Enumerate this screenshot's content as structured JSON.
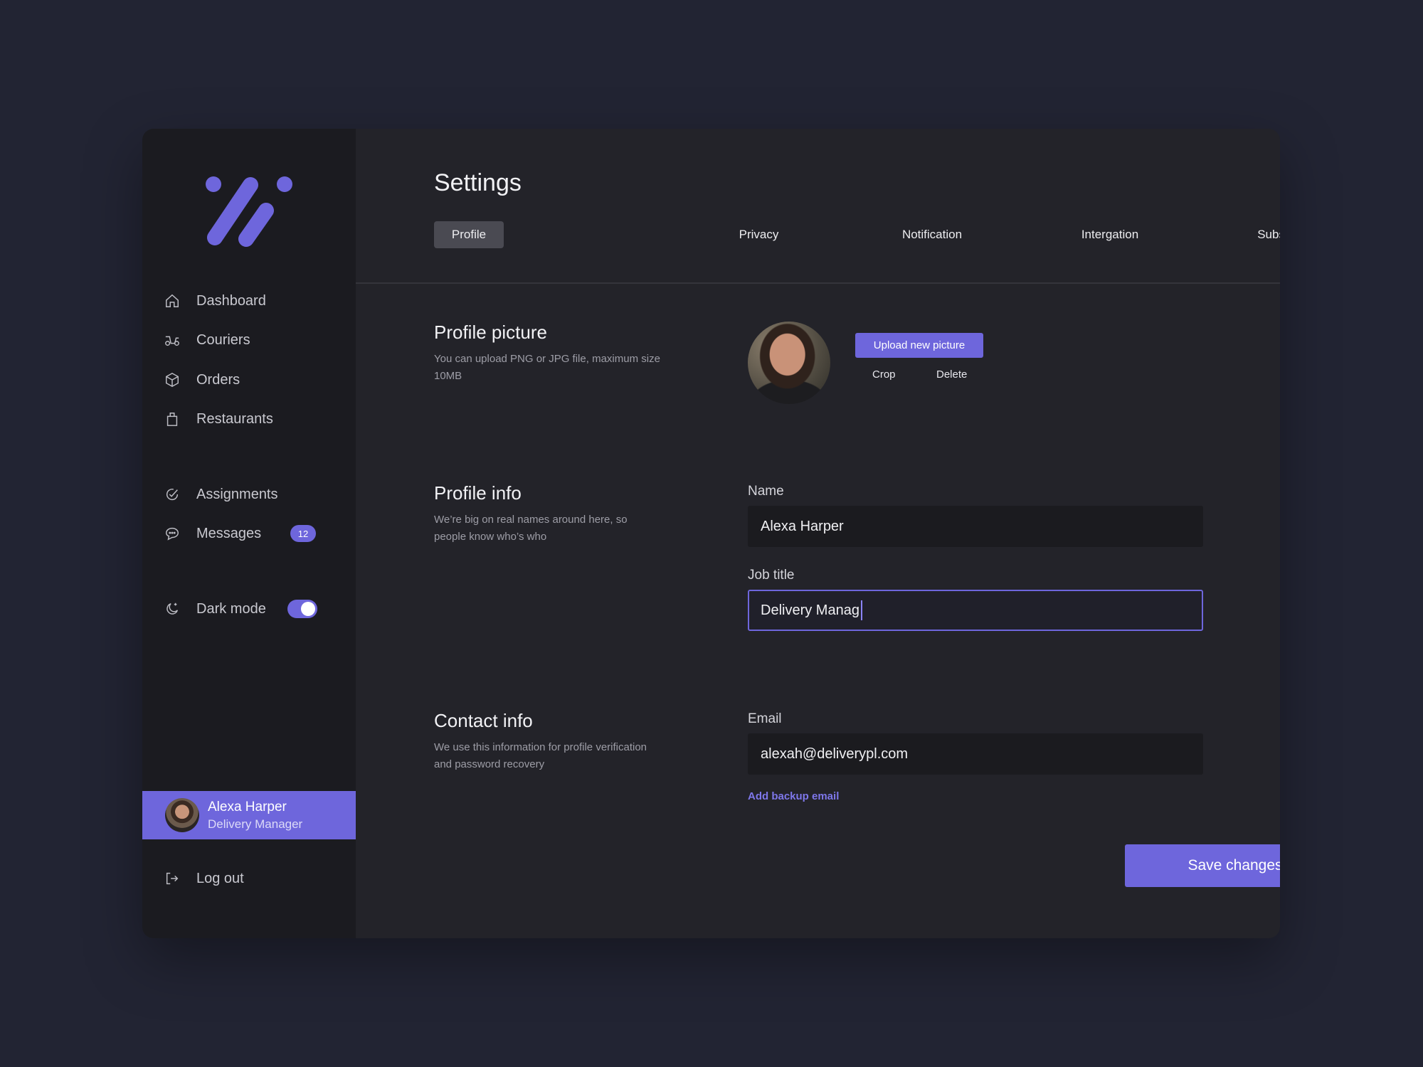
{
  "sidebar": {
    "items": [
      {
        "label": "Dashboard",
        "icon": "home-icon"
      },
      {
        "label": "Couriers",
        "icon": "scooter-icon"
      },
      {
        "label": "Orders",
        "icon": "box-icon"
      },
      {
        "label": "Restaurants",
        "icon": "bag-icon"
      },
      {
        "label": "Assignments",
        "icon": "check-circle-icon"
      },
      {
        "label": "Messages",
        "icon": "chat-icon",
        "badge": "12"
      }
    ],
    "dark_mode": {
      "label": "Dark mode",
      "enabled": true
    },
    "user": {
      "name": "Alexa Harper",
      "role": "Delivery Manager"
    },
    "logout_label": "Log out"
  },
  "header": {
    "title": "Settings",
    "tabs": [
      "Profile",
      "Privacy",
      "Notification",
      "Intergation",
      "Subscription"
    ],
    "active_tab": "Profile"
  },
  "profile_picture": {
    "title": "Profile picture",
    "description": "You can upload PNG or JPG file, maximum size 10MB",
    "upload_label": "Upload new picture",
    "crop_label": "Crop",
    "delete_label": "Delete"
  },
  "profile_info": {
    "title": "Profile info",
    "description": "We’re big on real names around here, so people know who’s who",
    "name_label": "Name",
    "name_value": "Alexa Harper",
    "job_label": "Job title",
    "job_value": "Delivery Manag"
  },
  "contact_info": {
    "title": "Contact info",
    "description": "We use this information for profile verification and password recovery",
    "email_label": "Email",
    "email_value": "alexah@deliverypl.com",
    "backup_link": "Add backup email"
  },
  "save_label": "Save changes",
  "colors": {
    "accent": "#6e66dc",
    "background": "#222433",
    "panel": "#232329",
    "sidebar": "#1b1b20"
  }
}
